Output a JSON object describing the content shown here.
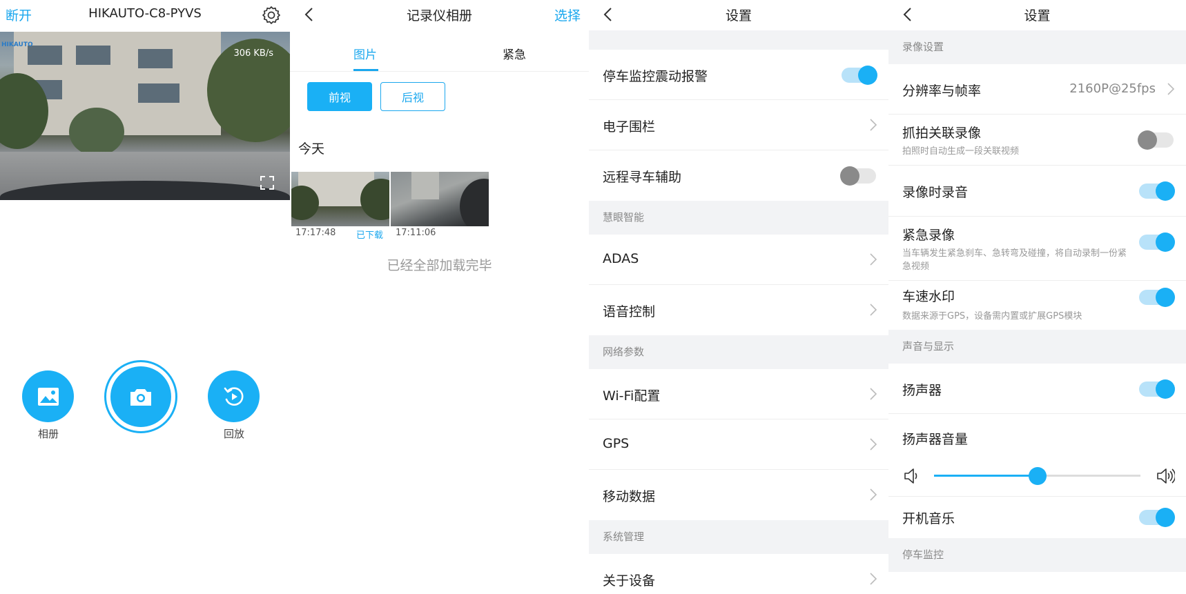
{
  "colors": {
    "accent": "#1aa7ee",
    "toggle_on": "#1ab0f5",
    "toggle_off": "#8a8a8a",
    "section_bg": "#f2f3f5"
  },
  "home": {
    "disconnect_label": "断开",
    "device_name": "HIKAUTO-C8-PYVS",
    "bitrate": "306 KB/s",
    "settings_icon": "gear-icon",
    "fullscreen_icon": "fullscreen-icon",
    "actions": [
      {
        "label": "相册",
        "icon": "image-icon"
      },
      {
        "label": "",
        "icon": "camera-icon"
      },
      {
        "label": "回放",
        "icon": "replay-icon"
      }
    ]
  },
  "album": {
    "title": "记录仪相册",
    "select_label": "选择",
    "tabs": [
      "图片",
      "紧急"
    ],
    "segments": [
      "前视",
      "后视"
    ],
    "day_label": "今天",
    "items": [
      {
        "time": "17:17:48",
        "status": "已下载"
      },
      {
        "time": "17:11:06",
        "status": ""
      }
    ],
    "end_text": "已经全部加载完毕"
  },
  "settings1": {
    "title": "设置",
    "toggle_rows": [
      {
        "label": "停车监控震动报警",
        "on": true
      }
    ],
    "items": {
      "geofence": "电子围栏",
      "remote_find": "远程寻车辅助",
      "adas": "ADAS",
      "voice": "语音控制",
      "wifi": "Wi-Fi配置",
      "gps": "GPS",
      "mobile": "移动数据",
      "about": "关于设备"
    },
    "remote_find_on": false,
    "sections": {
      "smart": "慧眼智能",
      "network": "网络参数",
      "system": "系统管理"
    }
  },
  "settings2": {
    "title": "设置",
    "sections": {
      "recording": "录像设置",
      "sound": "声音与显示",
      "parking": "停车监控"
    },
    "resolution": {
      "label": "分辨率与帧率",
      "value": "2160P@25fps"
    },
    "snap_record": {
      "label": "抓拍关联录像",
      "desc": "拍照时自动生成一段关联视频",
      "on": false
    },
    "record_audio": {
      "label": "录像时录音",
      "on": true
    },
    "emergency": {
      "label": "紧急录像",
      "desc": "当车辆发生紧急刹车、急转弯及碰撞，将自动录制一份紧急视频",
      "on": true
    },
    "speed_watermark": {
      "label": "车速水印",
      "desc": "数据来源于GPS，设备需内置或扩展GPS模块",
      "on": true
    },
    "speaker": {
      "label": "扬声器",
      "on": true
    },
    "volume": {
      "label": "扬声器音量",
      "level": 0.5
    },
    "boot_music": {
      "label": "开机音乐",
      "on": true
    }
  }
}
